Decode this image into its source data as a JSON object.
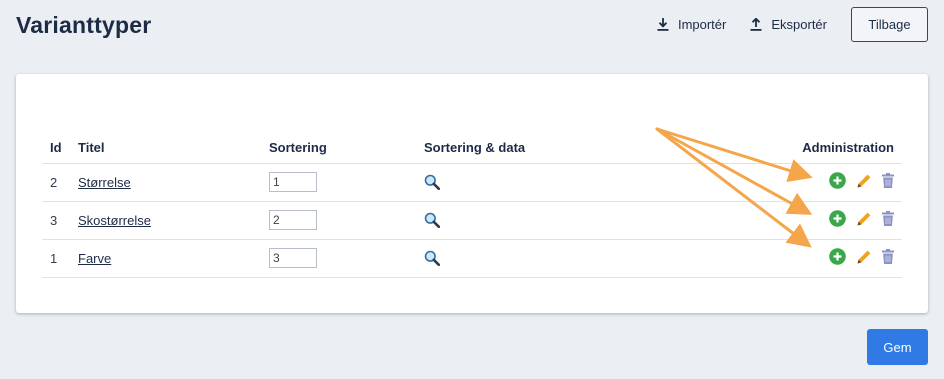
{
  "page": {
    "title": "Varianttyper"
  },
  "header": {
    "import_label": "Importér",
    "export_label": "Eksportér",
    "back_label": "Tilbage"
  },
  "table": {
    "columns": {
      "id": "Id",
      "title": "Titel",
      "sort": "Sortering",
      "sort_data": "Sortering & data",
      "admin": "Administration"
    },
    "rows": [
      {
        "id": "2",
        "title": "Størrelse",
        "sort": "1"
      },
      {
        "id": "3",
        "title": "Skostørrelse",
        "sort": "2"
      },
      {
        "id": "1",
        "title": "Farve",
        "sort": "3"
      }
    ]
  },
  "footer": {
    "save_label": "Gem"
  },
  "icons": {
    "import": "download-icon",
    "export": "upload-icon",
    "sort_data": "magnifier-icon",
    "add": "plus-circle-icon",
    "edit": "pencil-icon",
    "delete": "trash-icon"
  },
  "colors": {
    "primary": "#2f7ae5",
    "add": "#3aa84a",
    "edit": "#f0a323",
    "delete": "#8a93c4",
    "annotation_arrow": "#f5a54a"
  }
}
